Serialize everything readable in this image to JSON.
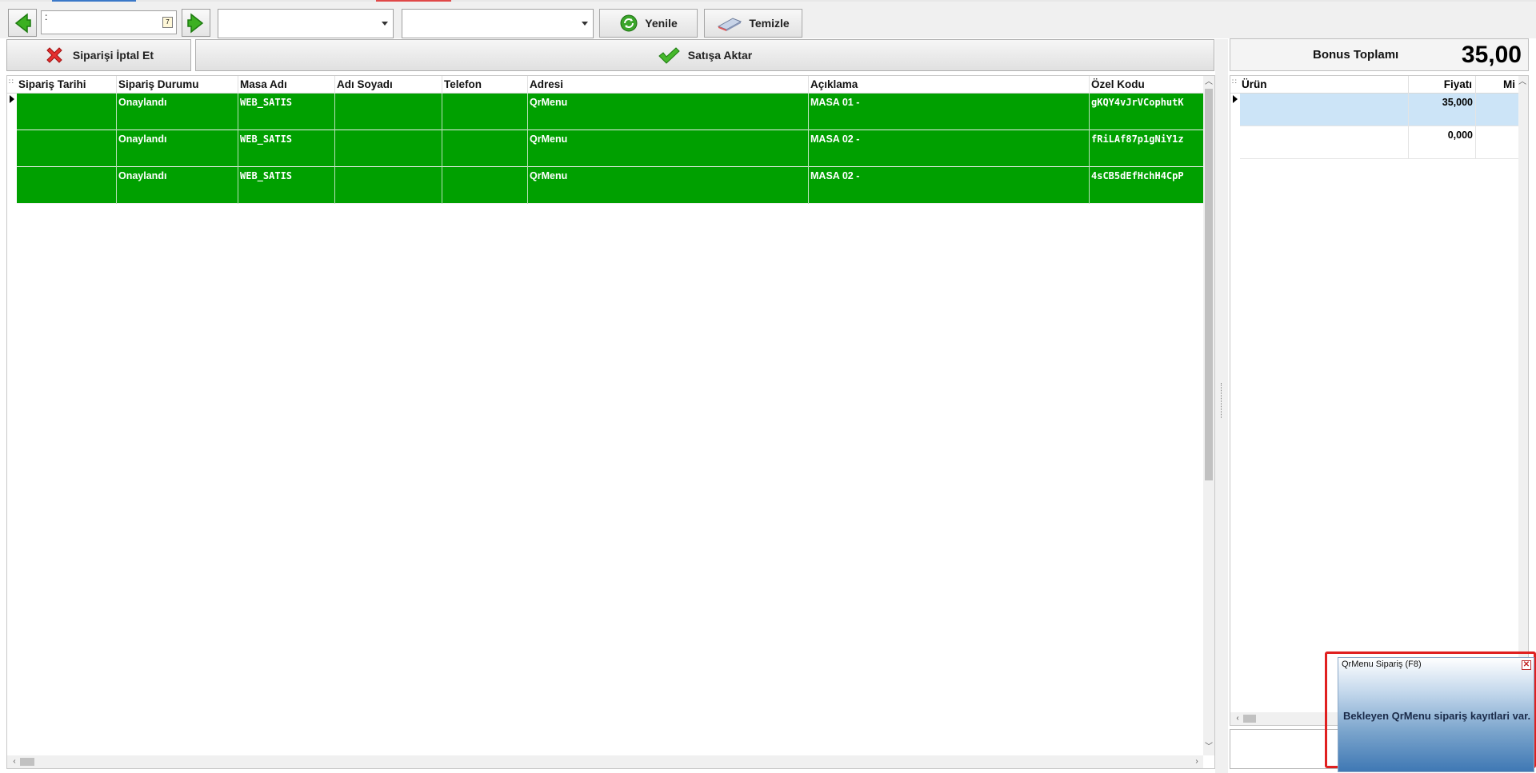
{
  "toolbar": {
    "prev_icon": "arrow-left-icon",
    "next_icon": "arrow-right-icon",
    "date_value": ":",
    "combo1_value": "",
    "combo2_value": "",
    "refresh_label": "Yenile",
    "clear_label": "Temizle"
  },
  "actions": {
    "cancel_label": "Siparişi İptal Et",
    "transfer_label": "Satışa Aktar"
  },
  "orders": {
    "columns": [
      "Sipariş Tarihi",
      "Sipariş Durumu",
      "Masa Adı",
      "Adı Soyadı",
      "Telefon",
      "Adresi",
      "Açıklama",
      "Özel Kodu"
    ],
    "rows": [
      {
        "date": "",
        "status": "Onaylandı",
        "table": "WEB_SATIS",
        "name": "",
        "phone": "",
        "address": "QrMenu",
        "desc": "MASA 01 -",
        "code": "gKQY4vJrVCophutK"
      },
      {
        "date": "",
        "status": "Onaylandı",
        "table": "WEB_SATIS",
        "name": "",
        "phone": "",
        "address": "QrMenu",
        "desc": "MASA 02 -",
        "code": "fRiLAf87p1gNiY1z"
      },
      {
        "date": "",
        "status": "Onaylandı",
        "table": "WEB_SATIS",
        "name": "",
        "phone": "",
        "address": "QrMenu",
        "desc": "MASA 02 -",
        "code": "4sCB5dEfHchH4CpP"
      }
    ],
    "row_color": "#00a000"
  },
  "bonus": {
    "label": "Bonus Toplamı",
    "value": "35,00"
  },
  "items": {
    "columns": [
      "Ürün",
      "Fiyatı",
      "Mi"
    ],
    "rows": [
      {
        "product": "",
        "price": "35,000",
        "qty": ""
      },
      {
        "product": "",
        "price": "0,000",
        "qty": ""
      }
    ]
  },
  "popup": {
    "title": "QrMenu Sipariş (F8)",
    "message": "Bekleyen QrMenu sipariş kayıtlari var.",
    "close_glyph": "✕"
  }
}
